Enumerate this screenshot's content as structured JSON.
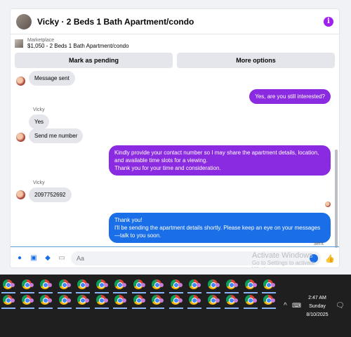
{
  "chat": {
    "title": "Vicky · 2 Beds 1 Bath Apartment/condo",
    "info_icon": "i",
    "marketplace_label": "Marketplace",
    "listing": "$1,050 - 2 Beds 1 Bath Apartment/condo",
    "mark_pending": "Mark as pending",
    "more_options": "More options"
  },
  "messages": {
    "m1": "Message sent",
    "m2": "Yes, are you still interested?",
    "sender": "Vicky",
    "m3": "Yes",
    "m4": "Send me number",
    "m5": "Kindly provide your contact number so I may share the apartment details, location, and available time slots for a viewing.\nThank you for your time and consideration.",
    "m6": "2097752692",
    "m7": "Thank you!\nI'll be sending the apartment details shortly. Please keep an eye on your messages—talk to you soon.",
    "sent": "Sent"
  },
  "composer": {
    "placeholder": "Aa"
  },
  "watermark": {
    "line1": "Activate Windows",
    "line2": "Go to Settings to activate Windows."
  },
  "clock": {
    "time": "2:47 AM",
    "day": "Sunday",
    "date": "8/10/2025"
  },
  "icons": {
    "info": "info-icon",
    "mic": "microphone-icon",
    "gallery": "gallery-icon",
    "sticker": "sticker-icon",
    "gif": "gif-icon",
    "like": "thumbs-up-icon",
    "taskbar_app": "chrome-profile-icon"
  },
  "colors": {
    "accent": "#1a6ee8",
    "purple": "#8a2be2",
    "info": "#a020f0"
  },
  "taskbar": {
    "apps": [
      "app-1",
      "app-2",
      "app-3",
      "app-4",
      "app-5",
      "app-6",
      "app-7",
      "app-8",
      "app-9",
      "app-10",
      "app-11",
      "app-12",
      "app-13",
      "app-14",
      "app-15",
      "app-16",
      "app-17",
      "app-18",
      "app-19",
      "app-20",
      "app-21",
      "app-22",
      "app-23",
      "app-24",
      "app-25",
      "app-26",
      "app-27",
      "app-28",
      "app-29",
      "app-30"
    ]
  }
}
